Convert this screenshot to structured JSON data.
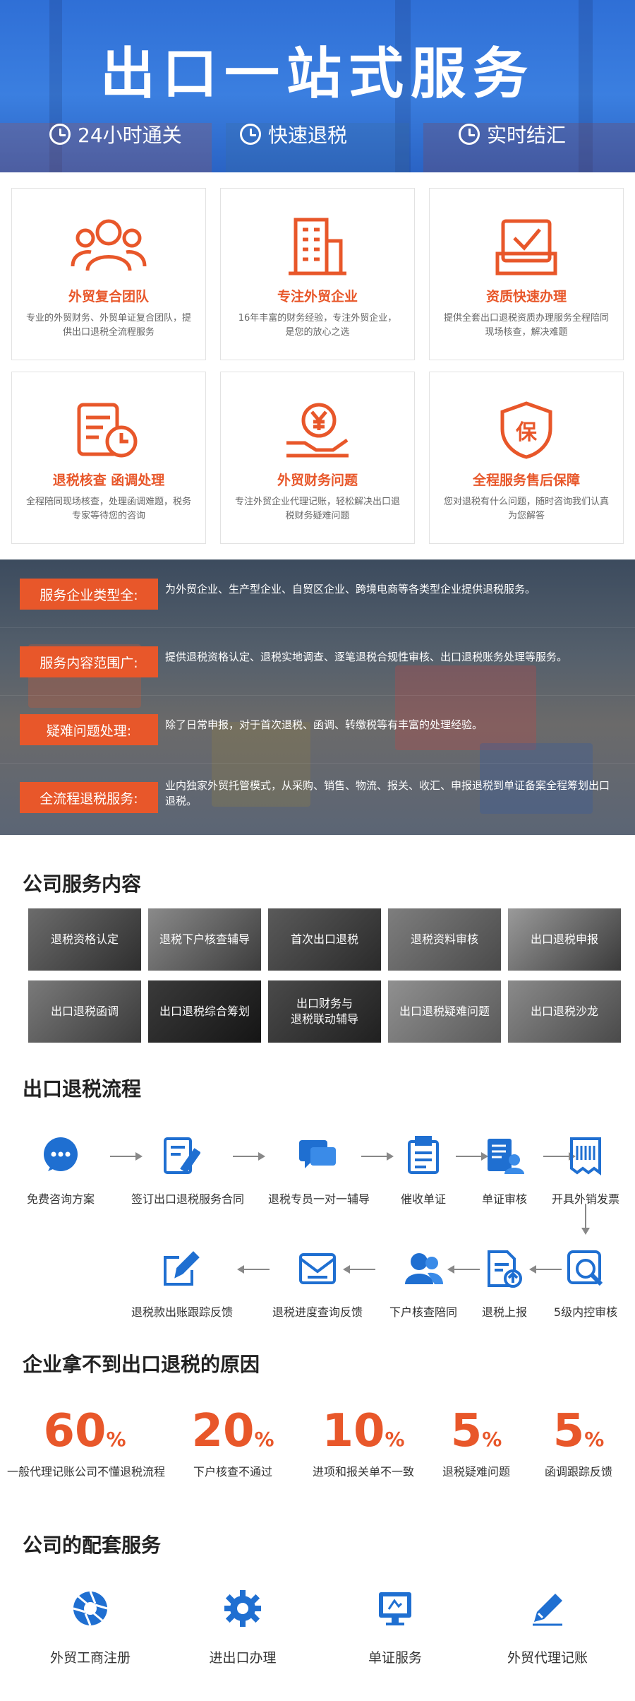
{
  "hero": {
    "title": "出口一站式服务",
    "features": [
      {
        "icon": "clock-icon",
        "label": "24小时通关"
      },
      {
        "icon": "yen-icon",
        "label": "快速退税"
      },
      {
        "icon": "timer-icon",
        "label": "实时结汇"
      }
    ]
  },
  "cards": [
    {
      "icon": "team-icon",
      "title": "外贸复合团队",
      "desc": "专业的外贸财务、外贸单证复合团队，提供出口退税全流程服务"
    },
    {
      "icon": "building-icon",
      "title": "专注外贸企业",
      "desc": "16年丰富的财务经验，专注外贸企业，是您的放心之选"
    },
    {
      "icon": "check-box-icon",
      "title": "资质快速办理",
      "desc": "提供全套出口退税资质办理服务全程陪同现场核查，解决难题"
    },
    {
      "icon": "receipt-clock-icon",
      "title": "退税核查 函调处理",
      "desc": "全程陪同现场核查，处理函调难题，税务专家等待您的咨询"
    },
    {
      "icon": "yen-hand-icon",
      "title": "外贸财务问题",
      "desc": "专注外贸企业代理记账，轻松解决出口退税财务疑难问题"
    },
    {
      "icon": "shield-icon",
      "title": "全程服务售后保障",
      "desc": "您对退税有什么问题，随时咨询我们认真为您解答",
      "shield_char": "保"
    }
  ],
  "advantages": [
    {
      "label": "服务企业类型全:",
      "text": "为外贸企业、生产型企业、自贸区企业、跨境电商等各类型企业提供退税服务。"
    },
    {
      "label": "服务内容范围广:",
      "text": "提供退税资格认定、退税实地调查、逐笔退税合规性审核、出口退税账务处理等服务。"
    },
    {
      "label": "疑难问题处理:",
      "text": "除了日常申报，对于首次退税、函调、转缴税等有丰富的处理经验。"
    },
    {
      "label": "全流程退税服务:",
      "text": "业内独家外贸托管模式，从采购、销售、物流、报关、收汇、申报退税到单证备案全程筹划出口退税。"
    }
  ],
  "services": {
    "title": "公司服务内容",
    "tiles": [
      "退税资格认定",
      "退税下户核查辅导",
      "首次出口退税",
      "退税资料审核",
      "出口退税申报",
      "出口退税函调",
      "出口退税综合筹划",
      "出口财务与\n退税联动辅导",
      "出口退税疑难问题",
      "出口退税沙龙"
    ]
  },
  "flow": {
    "title": "出口退税流程",
    "row1": [
      {
        "icon": "chat-bubble-icon",
        "label": "免费咨询方案"
      },
      {
        "icon": "sign-contract-icon",
        "label": "签订出口退税服务合同"
      },
      {
        "icon": "message-icon",
        "label": "退税专员一对一辅导"
      },
      {
        "icon": "clipboard-icon",
        "label": "催收单证"
      },
      {
        "icon": "document-person-icon",
        "label": "单证审核"
      },
      {
        "icon": "barcode-receipt-icon",
        "label": "开具外销发票"
      }
    ],
    "row2": [
      {
        "icon": "edit-square-icon",
        "label": "退税款出账跟踪反馈"
      },
      {
        "icon": "mail-feedback-icon",
        "label": "退税进度查询反馈"
      },
      {
        "icon": "users-icon",
        "label": "下户核查陪同"
      },
      {
        "icon": "upload-doc-icon",
        "label": "退税上报"
      },
      {
        "icon": "magnifier-icon",
        "label": "5级内控审核"
      }
    ]
  },
  "reasons": {
    "title": "企业拿不到出口退税的原因",
    "items": [
      {
        "value": "60",
        "unit": "%",
        "label": "一般代理记账公司不懂退税流程"
      },
      {
        "value": "20",
        "unit": "%",
        "label": "下户核查不通过"
      },
      {
        "value": "10",
        "unit": "%",
        "label": "进项和报关单不一致"
      },
      {
        "value": "5",
        "unit": "%",
        "label": "退税疑难问题"
      },
      {
        "value": "5",
        "unit": "%",
        "label": "函调跟踪反馈"
      }
    ]
  },
  "support": {
    "title": "公司的配套服务",
    "items": [
      {
        "icon": "aperture-icon",
        "label": "外贸工商注册"
      },
      {
        "icon": "gear-icon",
        "label": "进出口办理"
      },
      {
        "icon": "monitor-icon",
        "label": "单证服务"
      },
      {
        "icon": "pen-icon",
        "label": "外贸代理记账"
      }
    ]
  },
  "colors": {
    "accent": "#e8572a",
    "blue": "#1f6fd1",
    "hero": "#2f6fd6"
  }
}
